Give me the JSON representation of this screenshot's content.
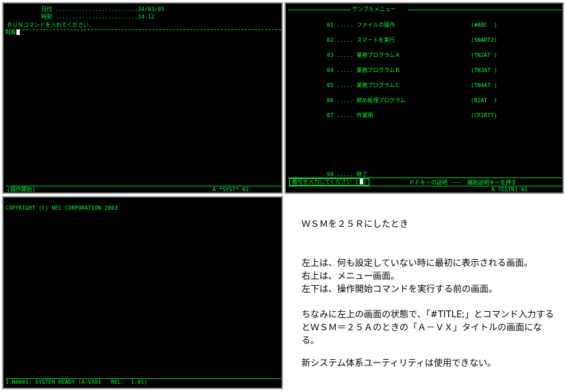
{
  "colors": {
    "screen_bg": "#000000",
    "text": "#00ff3a",
    "bezel": "#9e9e9e",
    "cursor": "#ffffff"
  },
  "top_left": {
    "date_line": "日付 .........................24/03/05",
    "time_line": "時刻 .........................14:12",
    "prompt_line": "ＲＵＮコマンドを入れてください.",
    "command": "RUN",
    "status_left": "(操作開始)",
    "status_right": "A *SYST* 01"
  },
  "top_right": {
    "title": "サンプルメニュー",
    "menu": [
      {
        "num": "01 .....",
        "label": "ファイルの操作",
        "code": "(#ABC  )"
      },
      {
        "num": "02 .....",
        "label": "スマートを実行",
        "code": "(SNART2)"
      },
      {
        "num": "03 .....",
        "label": "業務プログラムＡ",
        "code": "(TN2AT )"
      },
      {
        "num": "04 .....",
        "label": "業務プログラムＢ",
        "code": "(TN3AT )"
      },
      {
        "num": "05 .....",
        "label": "業務プログラムＣ",
        "code": "(TN4AT )"
      },
      {
        "num": "06 .....",
        "label": "締め処理プログラム",
        "code": "(B2AT  )"
      },
      {
        "num": "07 .....",
        "label": "作業用",
        "code": "(CR1RTT)"
      }
    ],
    "exit_item": "99 ..... 終了",
    "input_prompt": "番号を入力してください",
    "input_value": "",
    "pf_hint": "ＰＦキーの説明 ―――  補助説明キーを押す",
    "status_right": "A TESTN1 01"
  },
  "bottom_left": {
    "copyright": "COPYRIGHT (C) NEC CORPORATION 2003",
    "status": "I N0001: SYSTEN READY (A-VX01   REL.  1.01)"
  },
  "notes": {
    "heading": "ＷＳＭを２５Ｒにしたとき",
    "para1": "左上は、何も設定していない時に最初に表示される画面。",
    "para2": "右上は、メニュー画面。",
    "para3": "左下は、操作開始コマンドを実行する前の画面。",
    "para4": "ちなみに左上の画面の状態で、「#TITLE;」とコマンド入力するとＷＳＭ＝２５Ａのときの「Ａ－ＶＸ」タイトルの画面になる。",
    "para5": "新システム体系ユーティリティは使用できない。"
  }
}
